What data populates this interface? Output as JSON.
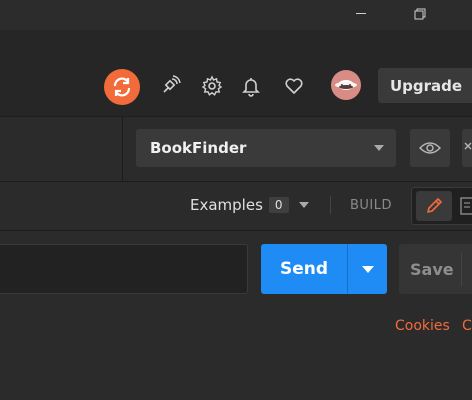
{
  "window": {
    "controls": [
      "minimize",
      "restore"
    ]
  },
  "header": {
    "icons": [
      "sync-icon",
      "satellite-icon",
      "settings-icon",
      "bell-icon",
      "heart-icon",
      "avatar"
    ],
    "upgrade_label": "Upgrade"
  },
  "environment": {
    "selected": "BookFinder"
  },
  "subbar": {
    "examples_label": "Examples",
    "examples_count": "0",
    "build_label": "BUILD"
  },
  "request": {
    "send_label": "Send",
    "save_label": "Save",
    "links": [
      "Cookies",
      "C"
    ]
  },
  "colors": {
    "accent": "#f26b3a",
    "send": "#1f8cf5",
    "background": "#2b2b2b"
  }
}
